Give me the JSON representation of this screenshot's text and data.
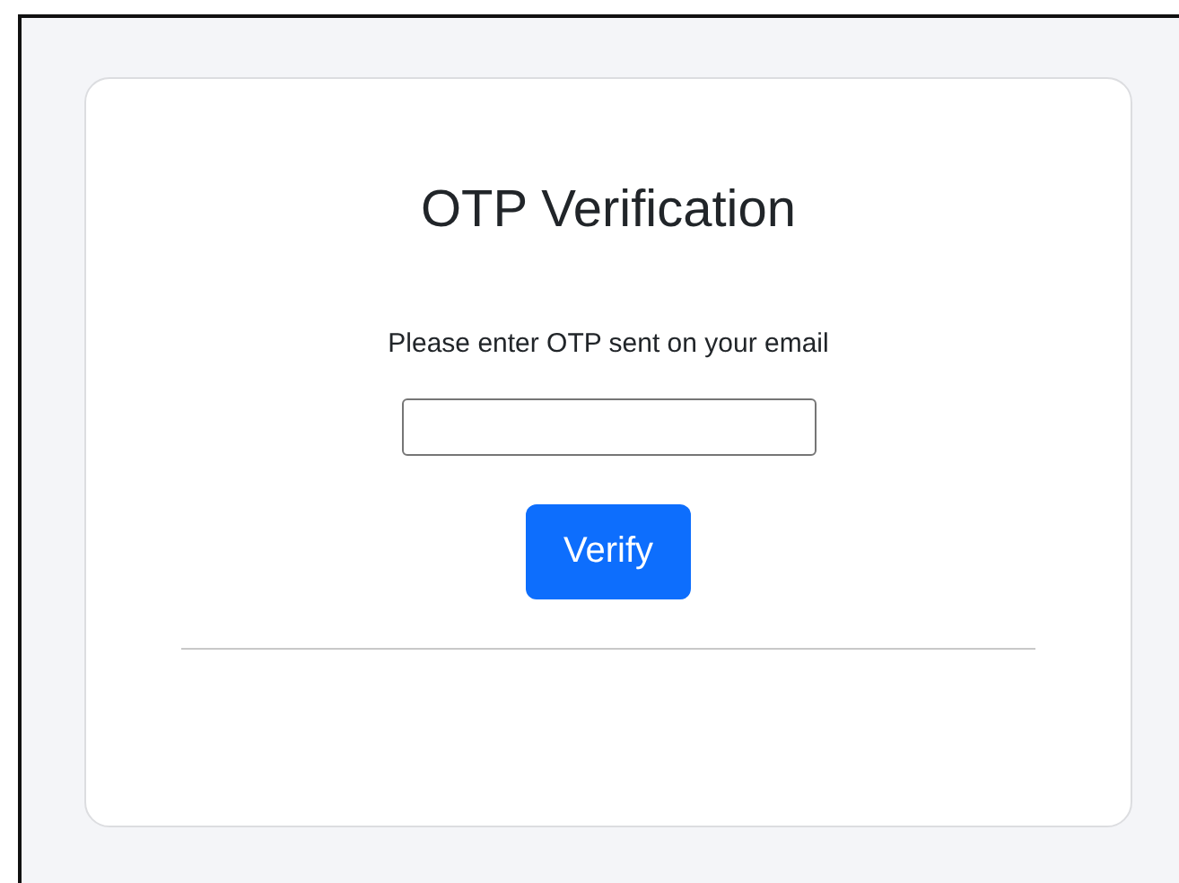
{
  "card": {
    "title": "OTP Verification",
    "instruction": "Please enter OTP sent on your email",
    "button": "Verify"
  }
}
